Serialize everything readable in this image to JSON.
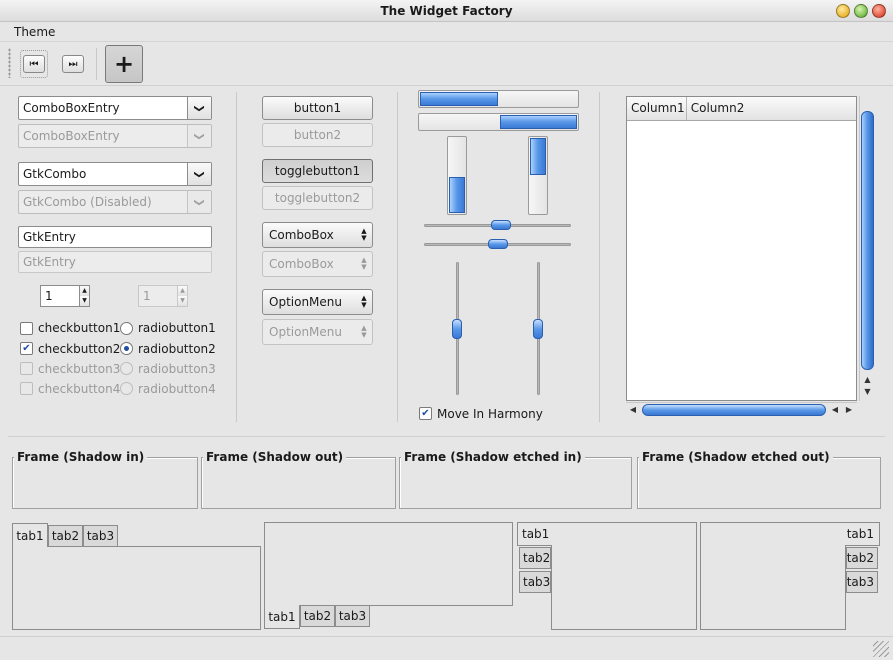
{
  "window": {
    "title": "The Widget Factory"
  },
  "menubar": {
    "items": [
      "Theme"
    ]
  },
  "toolbar": {
    "first_icon": "⏮",
    "last_icon": "⏭",
    "add_icon": "+"
  },
  "combos": {
    "combo_entry": "ComboBoxEntry",
    "combo_entry_disabled": "ComboBoxEntry",
    "gtk_combo": "GtkCombo",
    "gtk_combo_disabled": "GtkCombo (Disabled)",
    "arrow": "❯"
  },
  "entries": {
    "entry": "GtkEntry",
    "entry_disabled": "GtkEntry"
  },
  "spinners": {
    "spin": "1",
    "spin_disabled": "1"
  },
  "checks": [
    {
      "label": "checkbutton1",
      "checked": false,
      "disabled": false
    },
    {
      "label": "checkbutton2",
      "checked": true,
      "disabled": false
    },
    {
      "label": "checkbutton3",
      "checked": false,
      "disabled": true
    },
    {
      "label": "checkbutton4",
      "checked": false,
      "disabled": true
    }
  ],
  "radios": [
    {
      "label": "radiobutton1",
      "selected": false,
      "disabled": false
    },
    {
      "label": "radiobutton2",
      "selected": true,
      "disabled": false
    },
    {
      "label": "radiobutton3",
      "selected": false,
      "disabled": true
    },
    {
      "label": "radiobutton4",
      "selected": false,
      "disabled": true
    }
  ],
  "buttons": {
    "button1": "button1",
    "button2": "button2",
    "toggle1": "togglebutton1",
    "toggle2": "togglebutton2",
    "combobox": "ComboBox",
    "combobox_disabled": "ComboBox",
    "optionmenu": "OptionMenu",
    "optionmenu_disabled": "OptionMenu"
  },
  "progress": {
    "horizontal_1": 0.5,
    "horizontal_2": 0.5,
    "vertical_1": 0.5,
    "vertical_2": 0.5
  },
  "scales": {
    "hscale_1": 0.53,
    "hscale_2": 0.5,
    "vscale_1": 0.5,
    "vscale_2": 0.5
  },
  "harmony": {
    "label": "Move In Harmony",
    "checked": true
  },
  "tree": {
    "columns": [
      "Column1",
      "Column2"
    ]
  },
  "frames": [
    "Frame (Shadow in)",
    "Frame (Shadow out)",
    "Frame (Shadow etched in)",
    "Frame (Shadow etched out)"
  ],
  "notebooks": {
    "tabs": [
      "tab1",
      "tab2",
      "tab3"
    ]
  },
  "colors": {
    "accent": "#4a8ae0",
    "window_bg": "#e6e6e6"
  }
}
